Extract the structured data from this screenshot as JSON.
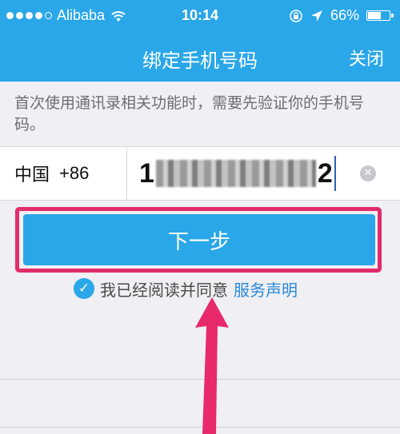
{
  "status_bar": {
    "carrier": "Alibaba",
    "time": "10:14",
    "battery": "66%",
    "battery_level": 0.66
  },
  "nav": {
    "title": "绑定手机号码",
    "close_label": "关闭"
  },
  "description": "首次使用通讯录相关功能时，需要先验证你的手机号码。",
  "phone": {
    "country": "中国",
    "code": "+86",
    "number_start": "1",
    "number_end": "2"
  },
  "next_button_label": "下一步",
  "agreement": {
    "text": "我已经阅读并同意",
    "link": "服务声明"
  },
  "colors": {
    "accent": "#2aa7e8",
    "highlight": "#e22d6a"
  }
}
